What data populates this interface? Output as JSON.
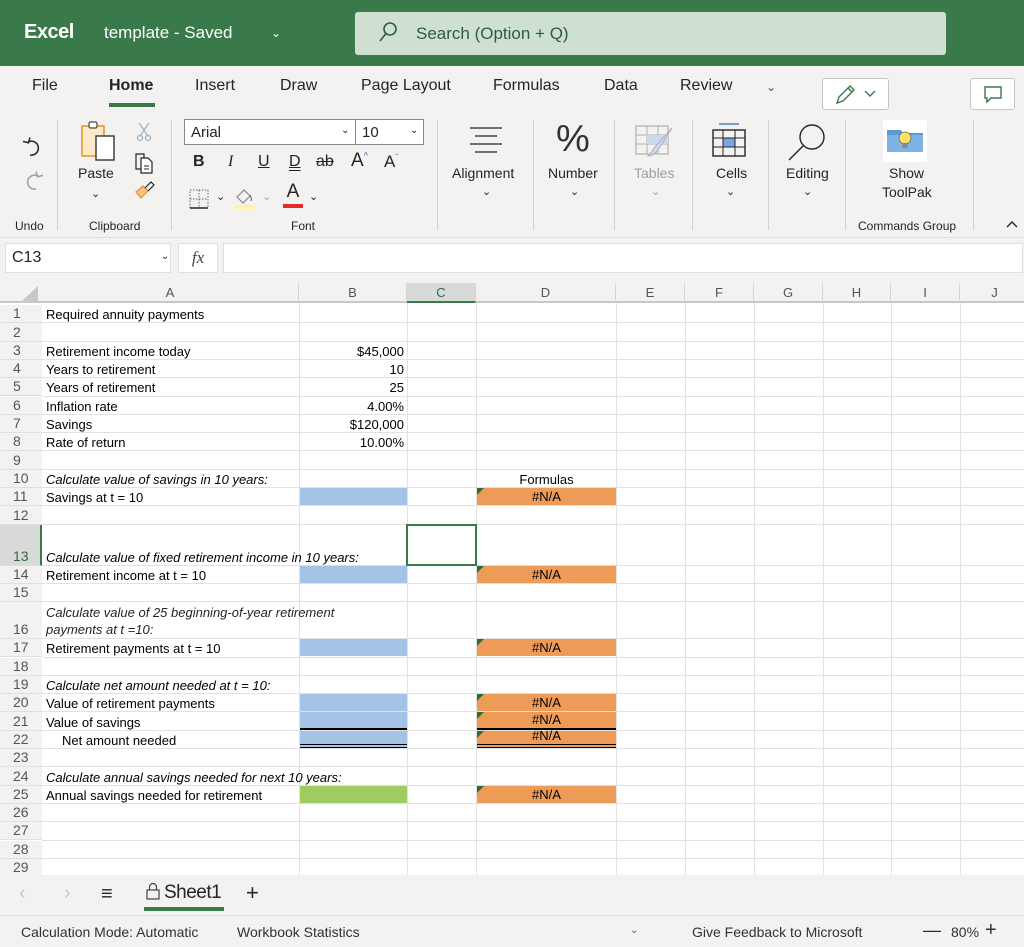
{
  "titlebar": {
    "app_name": "Excel",
    "doc_title": "template - Saved",
    "search_placeholder": "Search (Option + Q)"
  },
  "tabs": [
    {
      "label": "File"
    },
    {
      "label": "Home",
      "active": true
    },
    {
      "label": "Insert"
    },
    {
      "label": "Draw"
    },
    {
      "label": "Page Layout"
    },
    {
      "label": "Formulas"
    },
    {
      "label": "Data"
    },
    {
      "label": "Review"
    }
  ],
  "ribbon": {
    "undo_group": "Undo",
    "clipboard_group": "Clipboard",
    "paste_label": "Paste",
    "font_group": "Font",
    "font_name": "Arial",
    "font_size": "10",
    "bold": "B",
    "italic": "I",
    "underline": "U",
    "double_underline": "D",
    "strikethrough": "ab",
    "grow_font": "A",
    "shrink_font": "A",
    "font_color": "A",
    "alignment_label": "Alignment",
    "number_label": "Number",
    "tables_label": "Tables",
    "cells_label": "Cells",
    "editing_label": "Editing",
    "toolpak_label_1": "Show",
    "toolpak_label_2": "ToolPak",
    "commands_group": "Commands Group"
  },
  "formula_bar": {
    "name_box": "C13",
    "fx_label": "fx",
    "formula": ""
  },
  "columns": [
    "A",
    "B",
    "C",
    "D",
    "E",
    "F",
    "G",
    "H",
    "I",
    "J"
  ],
  "selected_column": "C",
  "selected_row": 13,
  "rows": [
    {
      "n": "1",
      "a": "Required annuity payments",
      "b": "",
      "d": ""
    },
    {
      "n": "2",
      "a": "",
      "b": "",
      "d": ""
    },
    {
      "n": "3",
      "a": "Retirement income today",
      "b": "$45,000",
      "d": ""
    },
    {
      "n": "4",
      "a": "Years to retirement",
      "b": "10",
      "d": ""
    },
    {
      "n": "5",
      "a": "Years of retirement",
      "b": "25",
      "d": ""
    },
    {
      "n": "6",
      "a": "Inflation rate",
      "b": "4.00%",
      "d": ""
    },
    {
      "n": "7",
      "a": "Savings",
      "b": "$120,000",
      "d": ""
    },
    {
      "n": "8",
      "a": "Rate of return",
      "b": "10.00%",
      "d": ""
    },
    {
      "n": "9",
      "a": "",
      "b": "",
      "d": ""
    },
    {
      "n": "10",
      "a": "Calculate value of savings in 10 years:",
      "b": "",
      "d": "Formulas"
    },
    {
      "n": "11",
      "a": "Savings at t = 10",
      "b": "",
      "d": "#N/A"
    },
    {
      "n": "12",
      "a": "",
      "b": "",
      "d": ""
    },
    {
      "n": "13",
      "a": "Calculate value of fixed retirement income in 10 years:",
      "b": "",
      "d": ""
    },
    {
      "n": "14",
      "a": "Retirement income at t = 10",
      "b": "",
      "d": "#N/A"
    },
    {
      "n": "15",
      "a": "",
      "b": "",
      "d": ""
    },
    {
      "n": "16",
      "a": "Calculate value of 25 beginning-of-year retirement payments at t =10:",
      "a_line1": "Calculate value of 25 beginning-of-year retirement",
      "a_line2": "payments at t =10:",
      "b": "",
      "d": ""
    },
    {
      "n": "17",
      "a": "Retirement payments at t = 10",
      "b": "",
      "d": "#N/A"
    },
    {
      "n": "18",
      "a": "",
      "b": "",
      "d": ""
    },
    {
      "n": "19",
      "a": "Calculate net amount needed at t = 10:",
      "b": "",
      "d": ""
    },
    {
      "n": "20",
      "a": "Value of retirement payments",
      "b": "",
      "d": "#N/A"
    },
    {
      "n": "21",
      "a": "Value of savings",
      "b": "",
      "d": "#N/A"
    },
    {
      "n": "22",
      "a": "Net amount needed",
      "b": "",
      "d": "#N/A"
    },
    {
      "n": "23",
      "a": "",
      "b": "",
      "d": ""
    },
    {
      "n": "24",
      "a": "Calculate annual savings needed for next 10 years:",
      "b": "",
      "d": ""
    },
    {
      "n": "25",
      "a": "Annual savings needed for retirement",
      "b": "",
      "d": "#N/A"
    },
    {
      "n": "26",
      "a": "",
      "b": "",
      "d": ""
    },
    {
      "n": "27",
      "a": "",
      "b": "",
      "d": ""
    },
    {
      "n": "28",
      "a": "",
      "b": "",
      "d": ""
    },
    {
      "n": "29",
      "a": "",
      "b": "",
      "d": ""
    }
  ],
  "colors": {
    "brand": "#3a7a4a",
    "input_blue": "#a3c4e6",
    "formula_orange": "#ee9b58",
    "result_green": "#9fcc5f"
  },
  "sheets": [
    {
      "label": "Sheet1",
      "active": true,
      "protected": true
    }
  ],
  "statusbar": {
    "calc_mode": "Calculation Mode: Automatic",
    "workbook_stats": "Workbook Statistics",
    "feedback": "Give Feedback to Microsoft",
    "zoom": "80%"
  }
}
